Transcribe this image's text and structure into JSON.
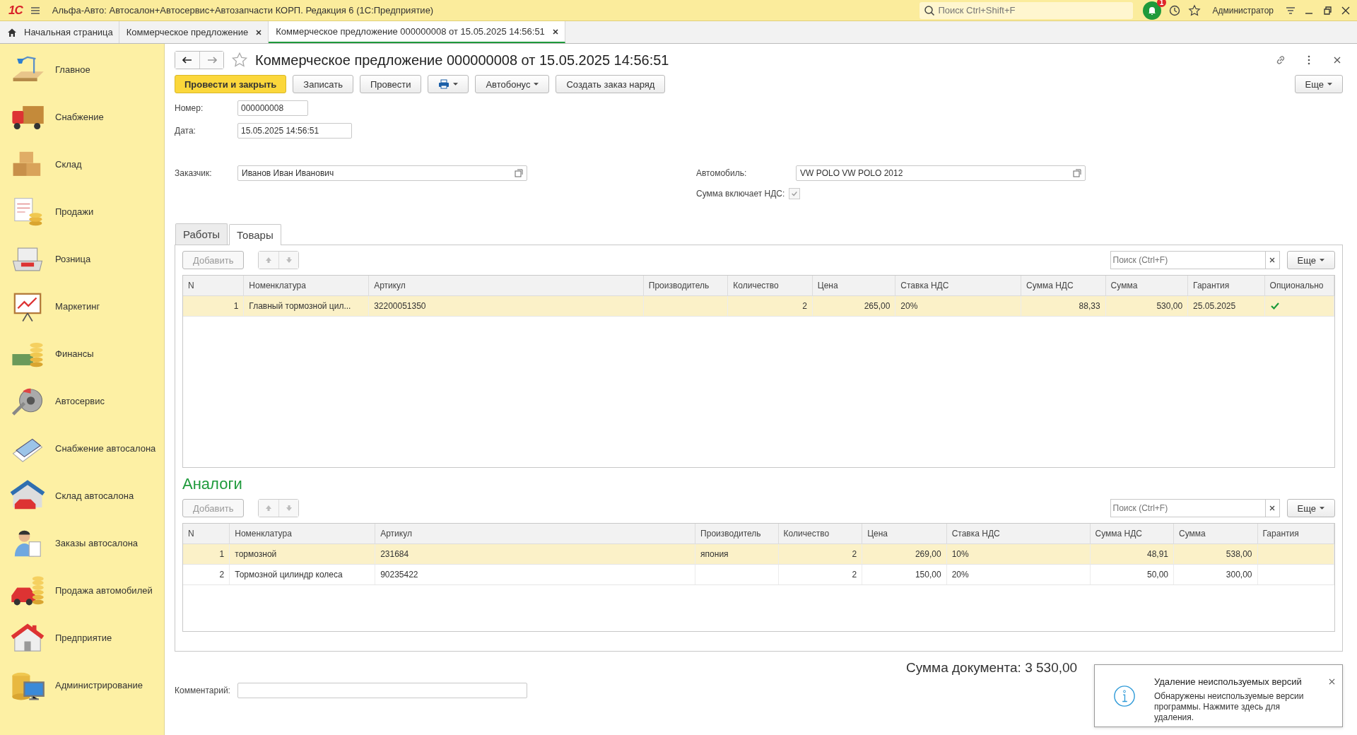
{
  "app": {
    "logo": "1С",
    "title": "Альфа-Авто: Автосалон+Автосервис+Автозапчасти КОРП. Редакция 6  (1С:Предприятие)",
    "search_placeholder": "Поиск Ctrl+Shift+F",
    "notification_count": "1",
    "user": "Администратор"
  },
  "open_tabs": [
    {
      "label": "Начальная страница",
      "kind": "home",
      "selected": false
    },
    {
      "label": "Коммерческое предложение",
      "kind": "doc",
      "selected": false
    },
    {
      "label": "Коммерческое предложение 000000008 от 15.05.2025 14:56:51",
      "kind": "doc",
      "selected": true
    }
  ],
  "sidebar": {
    "items": [
      {
        "label": "Главное"
      },
      {
        "label": "Снабжение"
      },
      {
        "label": "Склад"
      },
      {
        "label": "Продажи"
      },
      {
        "label": "Розница"
      },
      {
        "label": "Маркетинг"
      },
      {
        "label": "Финансы"
      },
      {
        "label": "Автосервис"
      },
      {
        "label": "Снабжение автосалона"
      },
      {
        "label": "Склад автосалона"
      },
      {
        "label": "Заказы автосалона"
      },
      {
        "label": "Продажа автомобилей"
      },
      {
        "label": "Предприятие"
      },
      {
        "label": "Администрирование"
      }
    ]
  },
  "document": {
    "title": "Коммерческое предложение 000000008 от 15.05.2025 14:56:51",
    "buttons": [
      {
        "label": "Провести и закрыть",
        "kind": "primary"
      },
      {
        "label": "Записать",
        "kind": "plain"
      },
      {
        "label": "Провести",
        "kind": "plain"
      },
      {
        "kind": "print"
      },
      {
        "label": "Автобонус",
        "kind": "dropdown"
      },
      {
        "label": "Создать заказ наряд",
        "kind": "plain"
      }
    ],
    "more_button": "Еще",
    "number": {
      "label": "Номер:",
      "value": "000000008"
    },
    "date": {
      "label": "Дата:",
      "value": "15.05.2025 14:56:51"
    },
    "customer": {
      "label": "Заказчик:",
      "value": "Иванов Иван Иванович"
    },
    "car": {
      "label": "Автомобиль:",
      "value": "VW POLO VW POLO 2012"
    },
    "vat_included": {
      "label": "Сумма включает НДС:",
      "checked": true
    },
    "tabs": [
      {
        "label": "Работы",
        "selected": false
      },
      {
        "label": "Товары",
        "selected": true
      }
    ],
    "goods": {
      "add_button": "Добавить",
      "search_placeholder": "Поиск (Ctrl+F)",
      "more_button": "Еще",
      "columns": [
        {
          "label": "N",
          "kind": "number"
        },
        {
          "label": "Номенклатура",
          "kind": "text"
        },
        {
          "label": "Артикул",
          "kind": "text"
        },
        {
          "label": "Производитель",
          "kind": "text"
        },
        {
          "label": "Количество",
          "kind": "number"
        },
        {
          "label": "Цена",
          "kind": "number"
        },
        {
          "label": "Ставка НДС",
          "kind": "text"
        },
        {
          "label": "Сумма НДС",
          "kind": "number"
        },
        {
          "label": "Сумма",
          "kind": "number"
        },
        {
          "label": "Гарантия",
          "kind": "text"
        },
        {
          "label": "Опционально",
          "kind": "check"
        }
      ],
      "rows": [
        {
          "selected": true,
          "cells": [
            "1",
            "Главный тормозной цил...",
            "32200051350",
            "",
            "2",
            "265,00",
            "20%",
            "88,33",
            "530,00",
            "25.05.2025"
          ],
          "optional": true
        }
      ]
    },
    "analogs": {
      "title": "Аналоги",
      "add_button": "Добавить",
      "search_placeholder": "Поиск (Ctrl+F)",
      "more_button": "Еще",
      "columns": [
        {
          "label": "N",
          "kind": "number"
        },
        {
          "label": "Номенклатура",
          "kind": "text"
        },
        {
          "label": "Артикул",
          "kind": "text"
        },
        {
          "label": "Производитель",
          "kind": "text"
        },
        {
          "label": "Количество",
          "kind": "number"
        },
        {
          "label": "Цена",
          "kind": "number"
        },
        {
          "label": "Ставка НДС",
          "kind": "text"
        },
        {
          "label": "Сумма НДС",
          "kind": "number"
        },
        {
          "label": "Сумма",
          "kind": "number"
        },
        {
          "label": "Гарантия",
          "kind": "text"
        }
      ],
      "rows": [
        {
          "selected": true,
          "cells": [
            "1",
            "тормозной",
            "231684",
            "япония",
            "2",
            "269,00",
            "10%",
            "48,91",
            "538,00",
            ""
          ]
        },
        {
          "selected": false,
          "cells": [
            "2",
            "Тормозной цилиндр колеса",
            "90235422",
            "",
            "2",
            "150,00",
            "20%",
            "50,00",
            "300,00",
            ""
          ]
        }
      ]
    },
    "total": "Сумма документа: 3 530,00",
    "comment": {
      "label": "Комментарий:"
    }
  },
  "notification": {
    "title": "Удаление неиспользуемых версий",
    "text": "Обнаружены неиспользуемые версии программы. Нажмите здесь для удаления."
  }
}
